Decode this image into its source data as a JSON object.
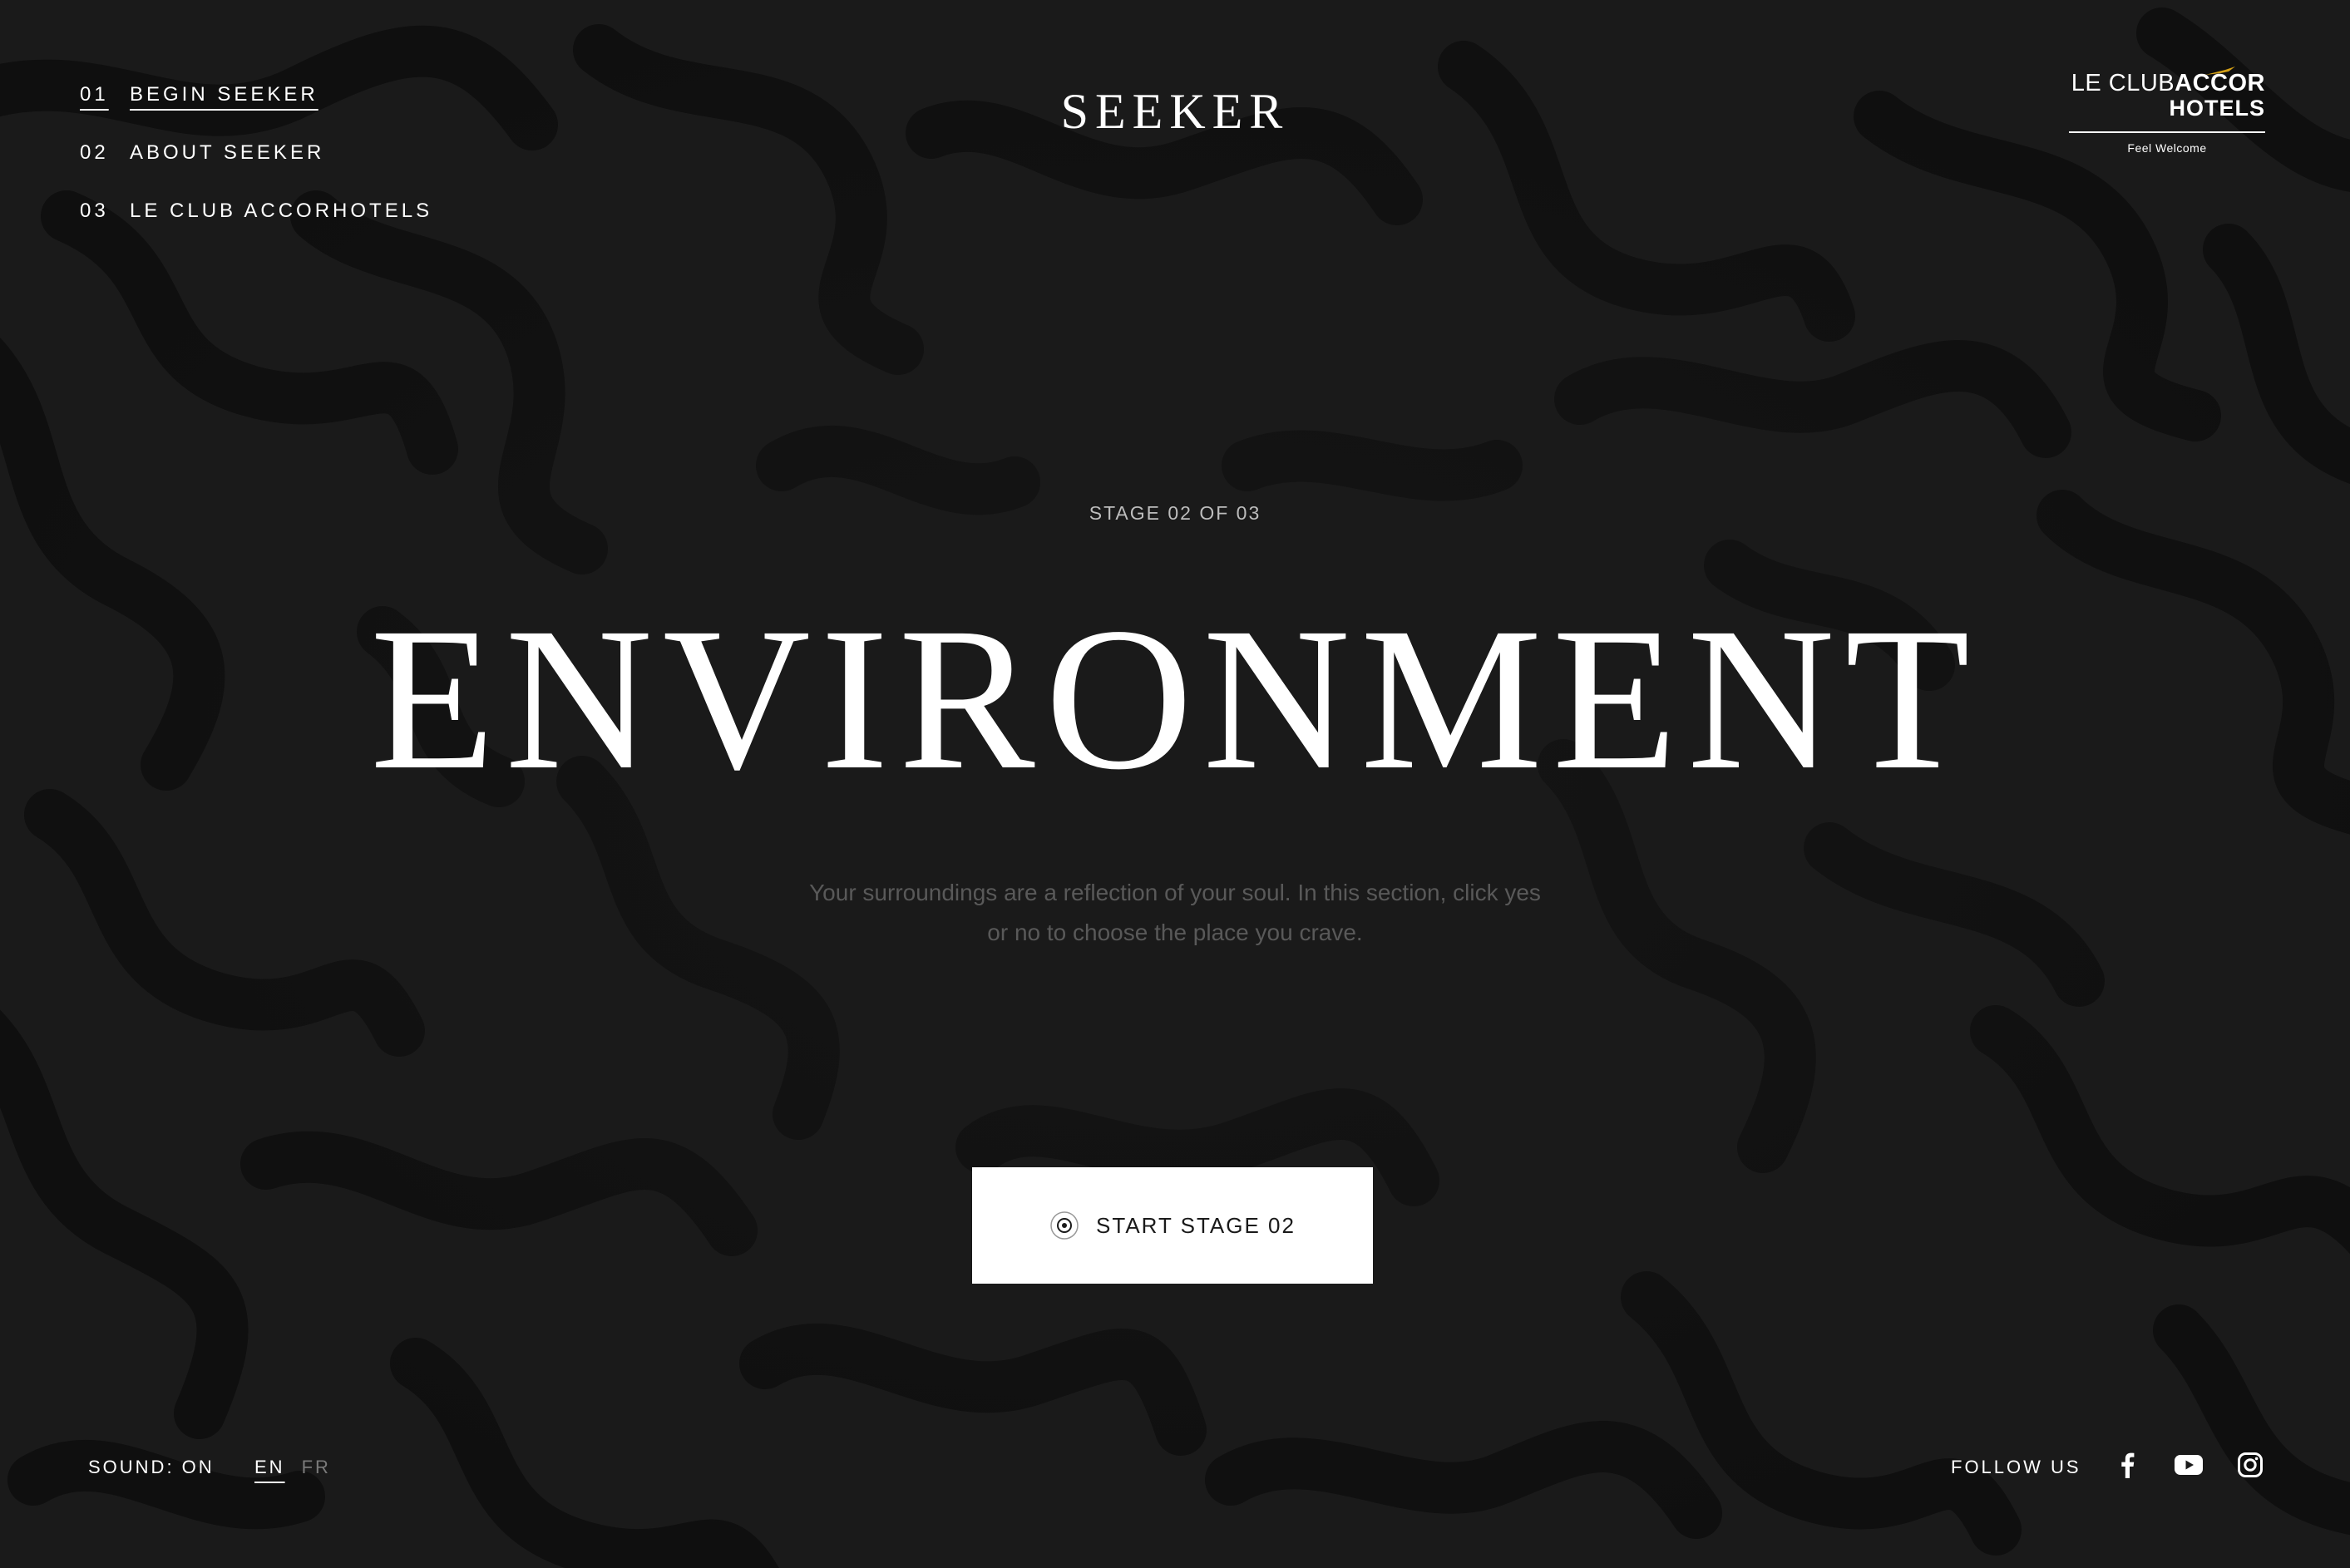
{
  "nav": {
    "items": [
      {
        "num": "01",
        "label": "BEGIN SEEKER",
        "active": true
      },
      {
        "num": "02",
        "label": "ABOUT SEEKER",
        "active": false
      },
      {
        "num": "03",
        "label": "LE CLUB ACCORHOTELS",
        "active": false
      }
    ]
  },
  "header": {
    "title": "SEEKER"
  },
  "logo": {
    "line1_thin": "LE CLUB",
    "line1_bold": "ACCOR",
    "line2": "HOTELS",
    "tagline": "Feel Welcome",
    "accent_color": "#d4a017"
  },
  "main": {
    "stage_label": "STAGE 02 OF 03",
    "headline": "ENVIRONMENT",
    "description": "Your surroundings are a reflection of your soul. In this section, click yes or no to choose the place you crave.",
    "cta_label": "START STAGE 02",
    "cta_icon": "target-icon"
  },
  "footer": {
    "sound_label": "SOUND: ON",
    "languages": [
      {
        "code": "EN",
        "active": true
      },
      {
        "code": "FR",
        "active": false
      }
    ],
    "follow_label": "FOLLOW US",
    "social": [
      "facebook-icon",
      "youtube-icon",
      "instagram-icon"
    ]
  },
  "colors": {
    "background": "#1a1a1a",
    "pattern": "#0f0f0f",
    "text": "#ffffff",
    "muted_text": "#595959",
    "button_bg": "#ffffff",
    "button_text": "#1a1a1a"
  }
}
